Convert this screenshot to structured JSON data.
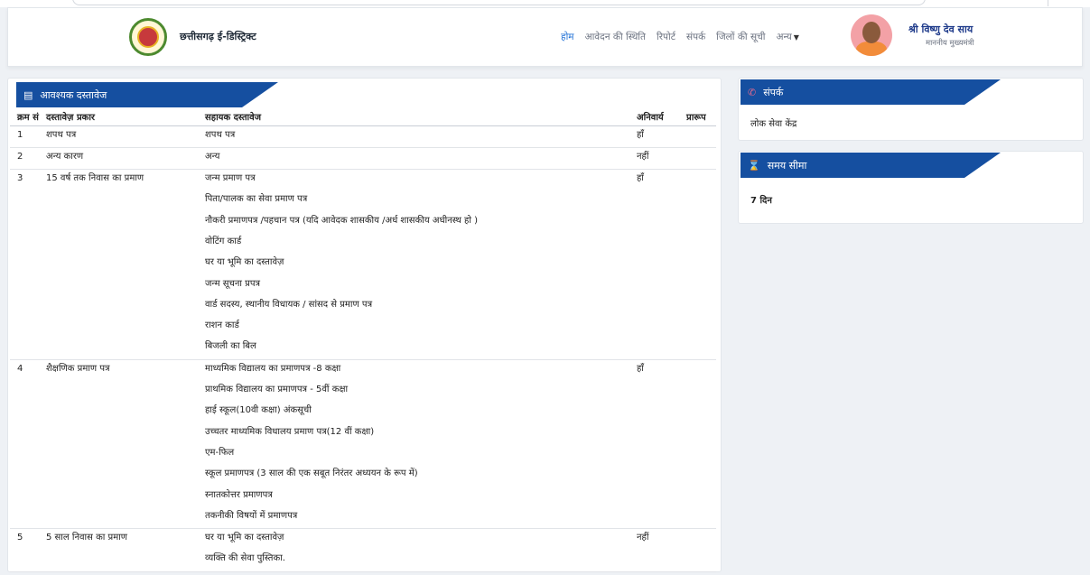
{
  "header": {
    "brand": "छत्तीसगढ़ ई-डिस्ट्रिक्ट",
    "nav": [
      {
        "label": "होम",
        "active": true
      },
      {
        "label": "आवेदन की स्थिति",
        "active": false
      },
      {
        "label": "रिपोर्ट",
        "active": false
      },
      {
        "label": "संपर्क",
        "active": false
      },
      {
        "label": "जिलों की सूची",
        "active": false
      },
      {
        "label": "अन्य",
        "active": false
      }
    ],
    "cm_name": "श्री विष्णु देव साय",
    "cm_title": "माननीय मुख्यमंत्री"
  },
  "documents": {
    "title": "आवश्यक दस्तावेज",
    "headers": [
      "क्रम सं",
      "दस्तावेज़ प्रकार",
      "सहायक दस्तावेज",
      "अनिवार्य",
      "प्रारूप"
    ],
    "rows": [
      {
        "no": "1",
        "type": "शपथ पत्र",
        "mandatory": "हाँ",
        "docs": [
          "शपथ पत्र"
        ]
      },
      {
        "no": "2",
        "type": "अन्य कारण",
        "mandatory": "नहीं",
        "docs": [
          "अन्य"
        ]
      },
      {
        "no": "3",
        "type": "15 वर्ष तक निवास का प्रमाण",
        "mandatory": "हाँ",
        "docs": [
          "जन्म प्रमाण पत्र",
          "पिता/पालक का सेवा प्रमाण पत्र",
          "नौकरी प्रमाणपत्र /पहचान पत्र (यदि आवेदक शासकीय /अर्ध शासकीय अधीनस्थ हो )",
          "वोटिंग कार्ड",
          "घर या भूमि का दस्तावेज़",
          "जन्म सूचना प्रपत्र",
          "वार्ड सदस्य, स्थानीय विधायक / सांसद से प्रमाण पत्र",
          "राशन कार्ड",
          "बिजली का बिल"
        ]
      },
      {
        "no": "4",
        "type": "शैक्षणिक प्रमाण पत्र",
        "mandatory": "हाँ",
        "docs": [
          "माध्यमिक विद्यालय का प्रमाणपत्र -8 कक्षा",
          "प्राथमिक विद्यालय का प्रमाणपत्र - 5वीं कक्षा",
          "हाई स्कूल(10वी कक्षा) अंकसूची",
          "उच्चतर माध्यमिक विधालय प्रमाण पत्र(12 वीं कक्षा)",
          "एम-फिल",
          "स्कूल प्रमाणपत्र (3 साल की एक सबूत निरंतर अध्ययन के रूप में)",
          "स्नातकोत्तर प्रमाणपत्र",
          "तकनीकी विषयों में प्रमाणपत्र"
        ]
      },
      {
        "no": "5",
        "type": "5 साल निवास का प्रमाण",
        "mandatory": "नहीं",
        "docs": [
          "घर या भूमि का दस्तावेज़",
          "व्यक्ति की सेवा पुस्तिका."
        ]
      }
    ]
  },
  "contact": {
    "title": "संपर्क",
    "text": "लोक सेवा केंद्र"
  },
  "timeline": {
    "title": "समय सीमा",
    "text": "7 दिन"
  },
  "colors": {
    "ribbon": "#154fa0",
    "nav_active": "#1d6fd6",
    "cm_name": "#1e3a8a"
  }
}
